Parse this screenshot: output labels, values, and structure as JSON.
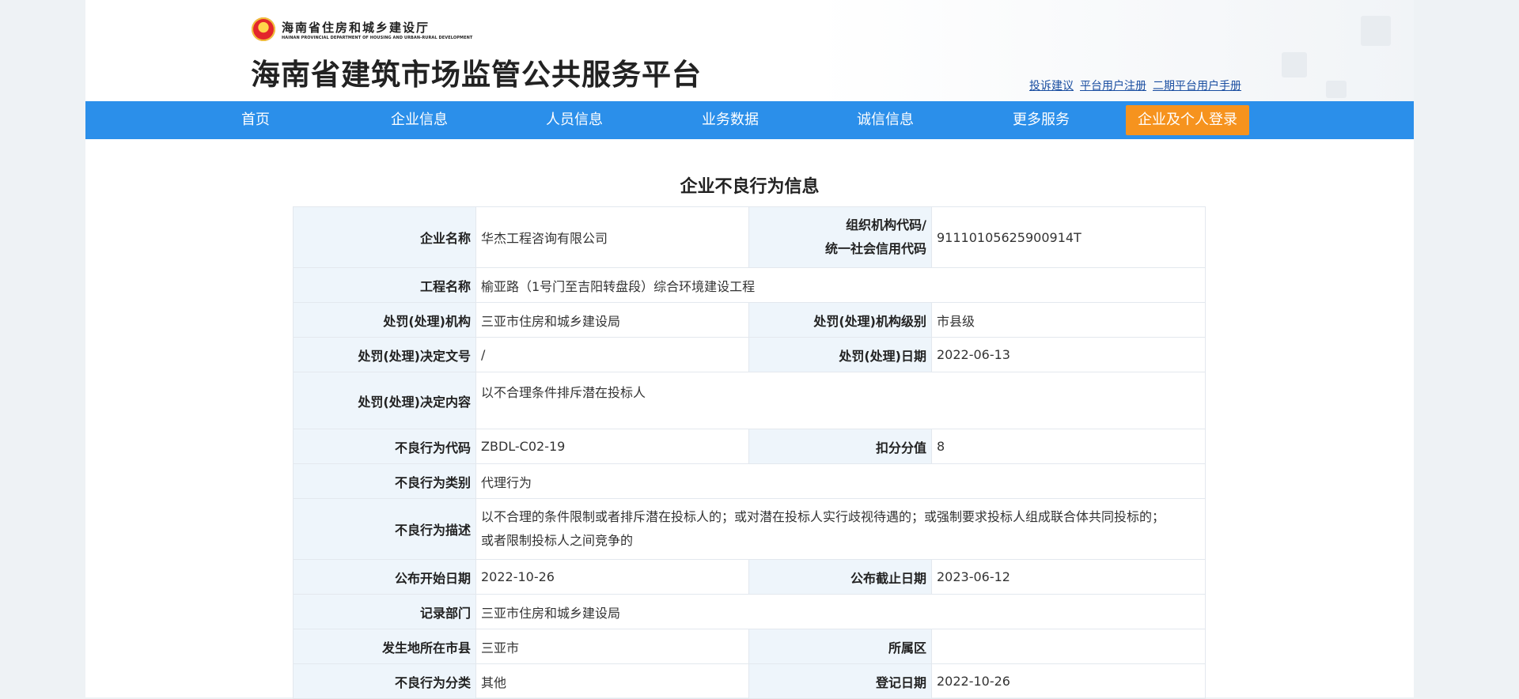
{
  "header": {
    "dept_cn": "海南省住房和城乡建设厅",
    "dept_en": "HAINAN PROVINCIAL DEPARTMENT OF HOUSING AND URBAN-RURAL DEVELOPMENT",
    "site_title": "海南省建筑市场监管公共服务平台",
    "links": [
      "投诉建议",
      "平台用户注册",
      "二期平台用户手册"
    ]
  },
  "nav": {
    "items": [
      "首页",
      "企业信息",
      "人员信息",
      "业务数据",
      "诚信信息",
      "更多服务"
    ],
    "login": "企业及个人登录"
  },
  "content": {
    "title": "企业不良行为信息",
    "rows": {
      "r1": {
        "l1": "企业名称",
        "v1": "华杰工程咨询有限公司",
        "l2a": "组织机构代码/",
        "l2b": "统一社会信用代码",
        "v2": "91110105625900914T"
      },
      "r2": {
        "l1": "工程名称",
        "v1": "榆亚路（1号门至吉阳转盘段）综合环境建设工程"
      },
      "r3": {
        "l1": "处罚(处理)机构",
        "v1": "三亚市住房和城乡建设局",
        "l2": "处罚(处理)机构级别",
        "v2": "市县级"
      },
      "r4": {
        "l1": "处罚(处理)决定文号",
        "v1": "/",
        "l2": "处罚(处理)日期",
        "v2": "2022-06-13"
      },
      "r5": {
        "l1": "处罚(处理)决定内容",
        "v1": "以不合理条件排斥潜在投标人"
      },
      "r6": {
        "l1": "不良行为代码",
        "v1": "ZBDL-C02-19",
        "l2": "扣分分值",
        "v2": "8"
      },
      "r7": {
        "l1": "不良行为类别",
        "v1": "代理行为"
      },
      "r8": {
        "l1": "不良行为描述",
        "v1a": "以不合理的条件限制或者排斥潜在投标人的；或对潜在投标人实行歧视待遇的；或强制要求投标人组成联合体共同投标的；",
        "v1b": "或者限制投标人之间竞争的"
      },
      "r9": {
        "l1": "公布开始日期",
        "v1": "2022-10-26",
        "l2": "公布截止日期",
        "v2": "2023-06-12"
      },
      "r10": {
        "l1": "记录部门",
        "v1": "三亚市住房和城乡建设局"
      },
      "r11": {
        "l1": "发生地所在市县",
        "v1": "三亚市",
        "l2": "所属区",
        "v2": ""
      },
      "r12": {
        "l1": "不良行为分类",
        "v1": "其他",
        "l2": "登记日期",
        "v2": "2022-10-26"
      }
    }
  }
}
